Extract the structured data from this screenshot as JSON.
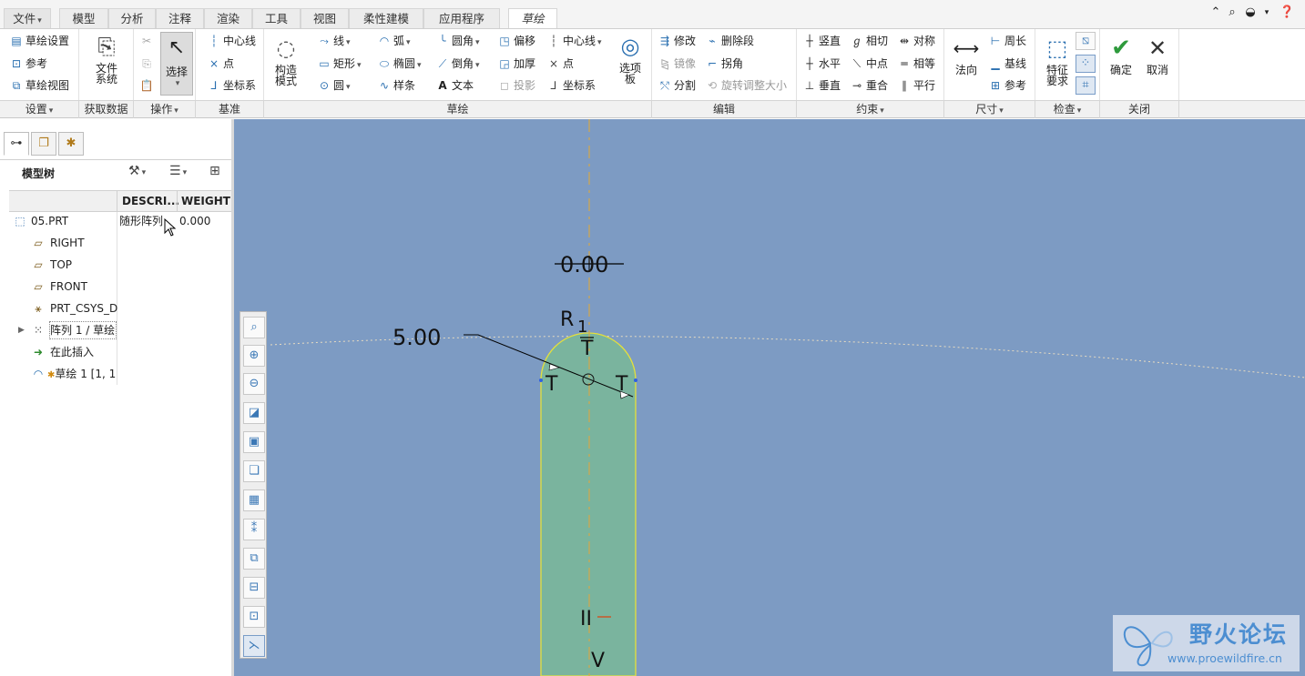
{
  "menu": {
    "file": "文件",
    "tabs": [
      "模型",
      "分析",
      "注释",
      "渲染",
      "工具",
      "视图",
      "柔性建模",
      "应用程序"
    ],
    "active_tab": "草绘"
  },
  "ribbon": {
    "setup": {
      "sketch_setup": "草绘设置",
      "references": "参考",
      "sketch_view": "草绘视图"
    },
    "get_data": {
      "file_system": [
        "文件",
        "系统"
      ]
    },
    "operations": {
      "select": "选择"
    },
    "datum": {
      "centerline": "中心线",
      "point": "点",
      "coord_sys": "坐标系"
    },
    "construction": {
      "label": [
        "构造",
        "模式"
      ]
    },
    "sketch": {
      "line": "线",
      "rectangle": "矩形",
      "circle": "圆",
      "arc": "弧",
      "ellipse": "椭圆",
      "spline": "样条",
      "fillet": "圆角",
      "chamfer": "倒角",
      "text": "文本",
      "offset": "偏移",
      "thicken": "加厚",
      "project": "投影",
      "centerline": "中心线",
      "point": "点",
      "coord_sys": "坐标系",
      "palette": [
        "选项",
        "板"
      ]
    },
    "edit": {
      "modify": "修改",
      "delete_segment": "删除段",
      "mirror": "镜像",
      "corner": "拐角",
      "divide": "分割",
      "rotate_resize": "旋转调整大小"
    },
    "constrain": {
      "vertical": "竖直",
      "tangent": "相切",
      "symmetric": "对称",
      "horizontal": "水平",
      "midpoint": "中点",
      "equal": "相等",
      "perpendicular": "垂直",
      "coincident": "重合",
      "parallel": "平行"
    },
    "dimension": {
      "normal": "法向",
      "perimeter": "周长",
      "baseline": "基线",
      "reference": "参考"
    },
    "inspect": {
      "feature_requirements": [
        "特征",
        "要求"
      ]
    },
    "close": {
      "ok": "确定",
      "cancel": "取消"
    }
  },
  "group_labels": [
    "设置",
    "获取数据",
    "操作",
    "基准",
    "草绘",
    "编辑",
    "约束",
    "尺寸",
    "检查",
    "关闭"
  ],
  "model_tree": {
    "title": "模型树",
    "columns": [
      "DESCRI...",
      "WEIGHT"
    ],
    "rows": [
      {
        "label": "05.PRT",
        "desc": "随形阵列",
        "weight": "0.000",
        "icon": "part-icon"
      },
      {
        "label": "RIGHT",
        "icon": "datum-plane-icon"
      },
      {
        "label": "TOP",
        "icon": "datum-plane-icon"
      },
      {
        "label": "FRONT",
        "icon": "datum-plane-icon"
      },
      {
        "label": "PRT_CSYS_DE",
        "icon": "csys-icon"
      },
      {
        "label": "阵列 1 / 草绘",
        "icon": "pattern-icon"
      },
      {
        "label": "在此插入",
        "icon": "insert-arrow-icon"
      },
      {
        "label": "草绘 1 [1, 1",
        "icon": "sketch-icon"
      }
    ]
  },
  "sketch": {
    "dim_horizontal": "0.00",
    "dim_diameter": "5.00",
    "radius_label": "R",
    "radius_index": "1",
    "tangent_marks": [
      "T",
      "T",
      "T"
    ],
    "parallel_mark": "II",
    "vertical_mark": "V",
    "colors": {
      "background": "#7d9bc3",
      "fill": "#7ab49e",
      "outline": "#e6e03a",
      "centerline": "#d4a84a"
    }
  },
  "watermark": {
    "title": "野火论坛",
    "url": "www.proewildfire.cn"
  }
}
